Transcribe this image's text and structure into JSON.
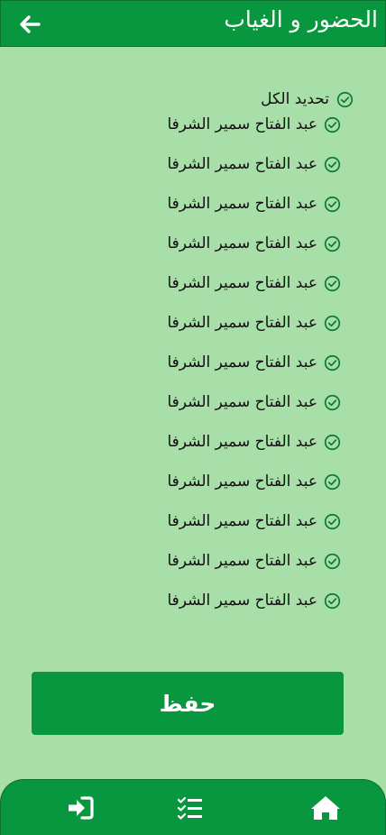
{
  "header": {
    "title": "الحضور و الغياب",
    "back_icon": "arrow-left-icon"
  },
  "select_all": {
    "label": "تحديد الكل",
    "icon": "check-circle-icon"
  },
  "students": [
    {
      "name": "عبد الفتاح سمير الشرفا"
    },
    {
      "name": "عبد الفتاح سمير الشرفا"
    },
    {
      "name": "عبد الفتاح سمير الشرفا"
    },
    {
      "name": "عبد الفتاح سمير الشرفا"
    },
    {
      "name": "عبد الفتاح سمير الشرفا"
    },
    {
      "name": "عبد الفتاح سمير الشرفا"
    },
    {
      "name": "عبد الفتاح سمير الشرفا"
    },
    {
      "name": "عبد الفتاح سمير الشرفا"
    },
    {
      "name": "عبد الفتاح سمير الشرفا"
    },
    {
      "name": "عبد الفتاح سمير الشرفا"
    },
    {
      "name": "عبد الفتاح سمير الشرفا"
    },
    {
      "name": "عبد الفتاح سمير الشرفا"
    },
    {
      "name": "عبد الفتاح سمير الشرفا"
    }
  ],
  "save_label": "حفظ",
  "bottom_nav": {
    "icons": [
      "logout-icon",
      "task-list-icon",
      "home-icon"
    ]
  },
  "colors": {
    "primary": "#08963f",
    "background": "#a8dfa8",
    "check": "#0b7a35"
  }
}
